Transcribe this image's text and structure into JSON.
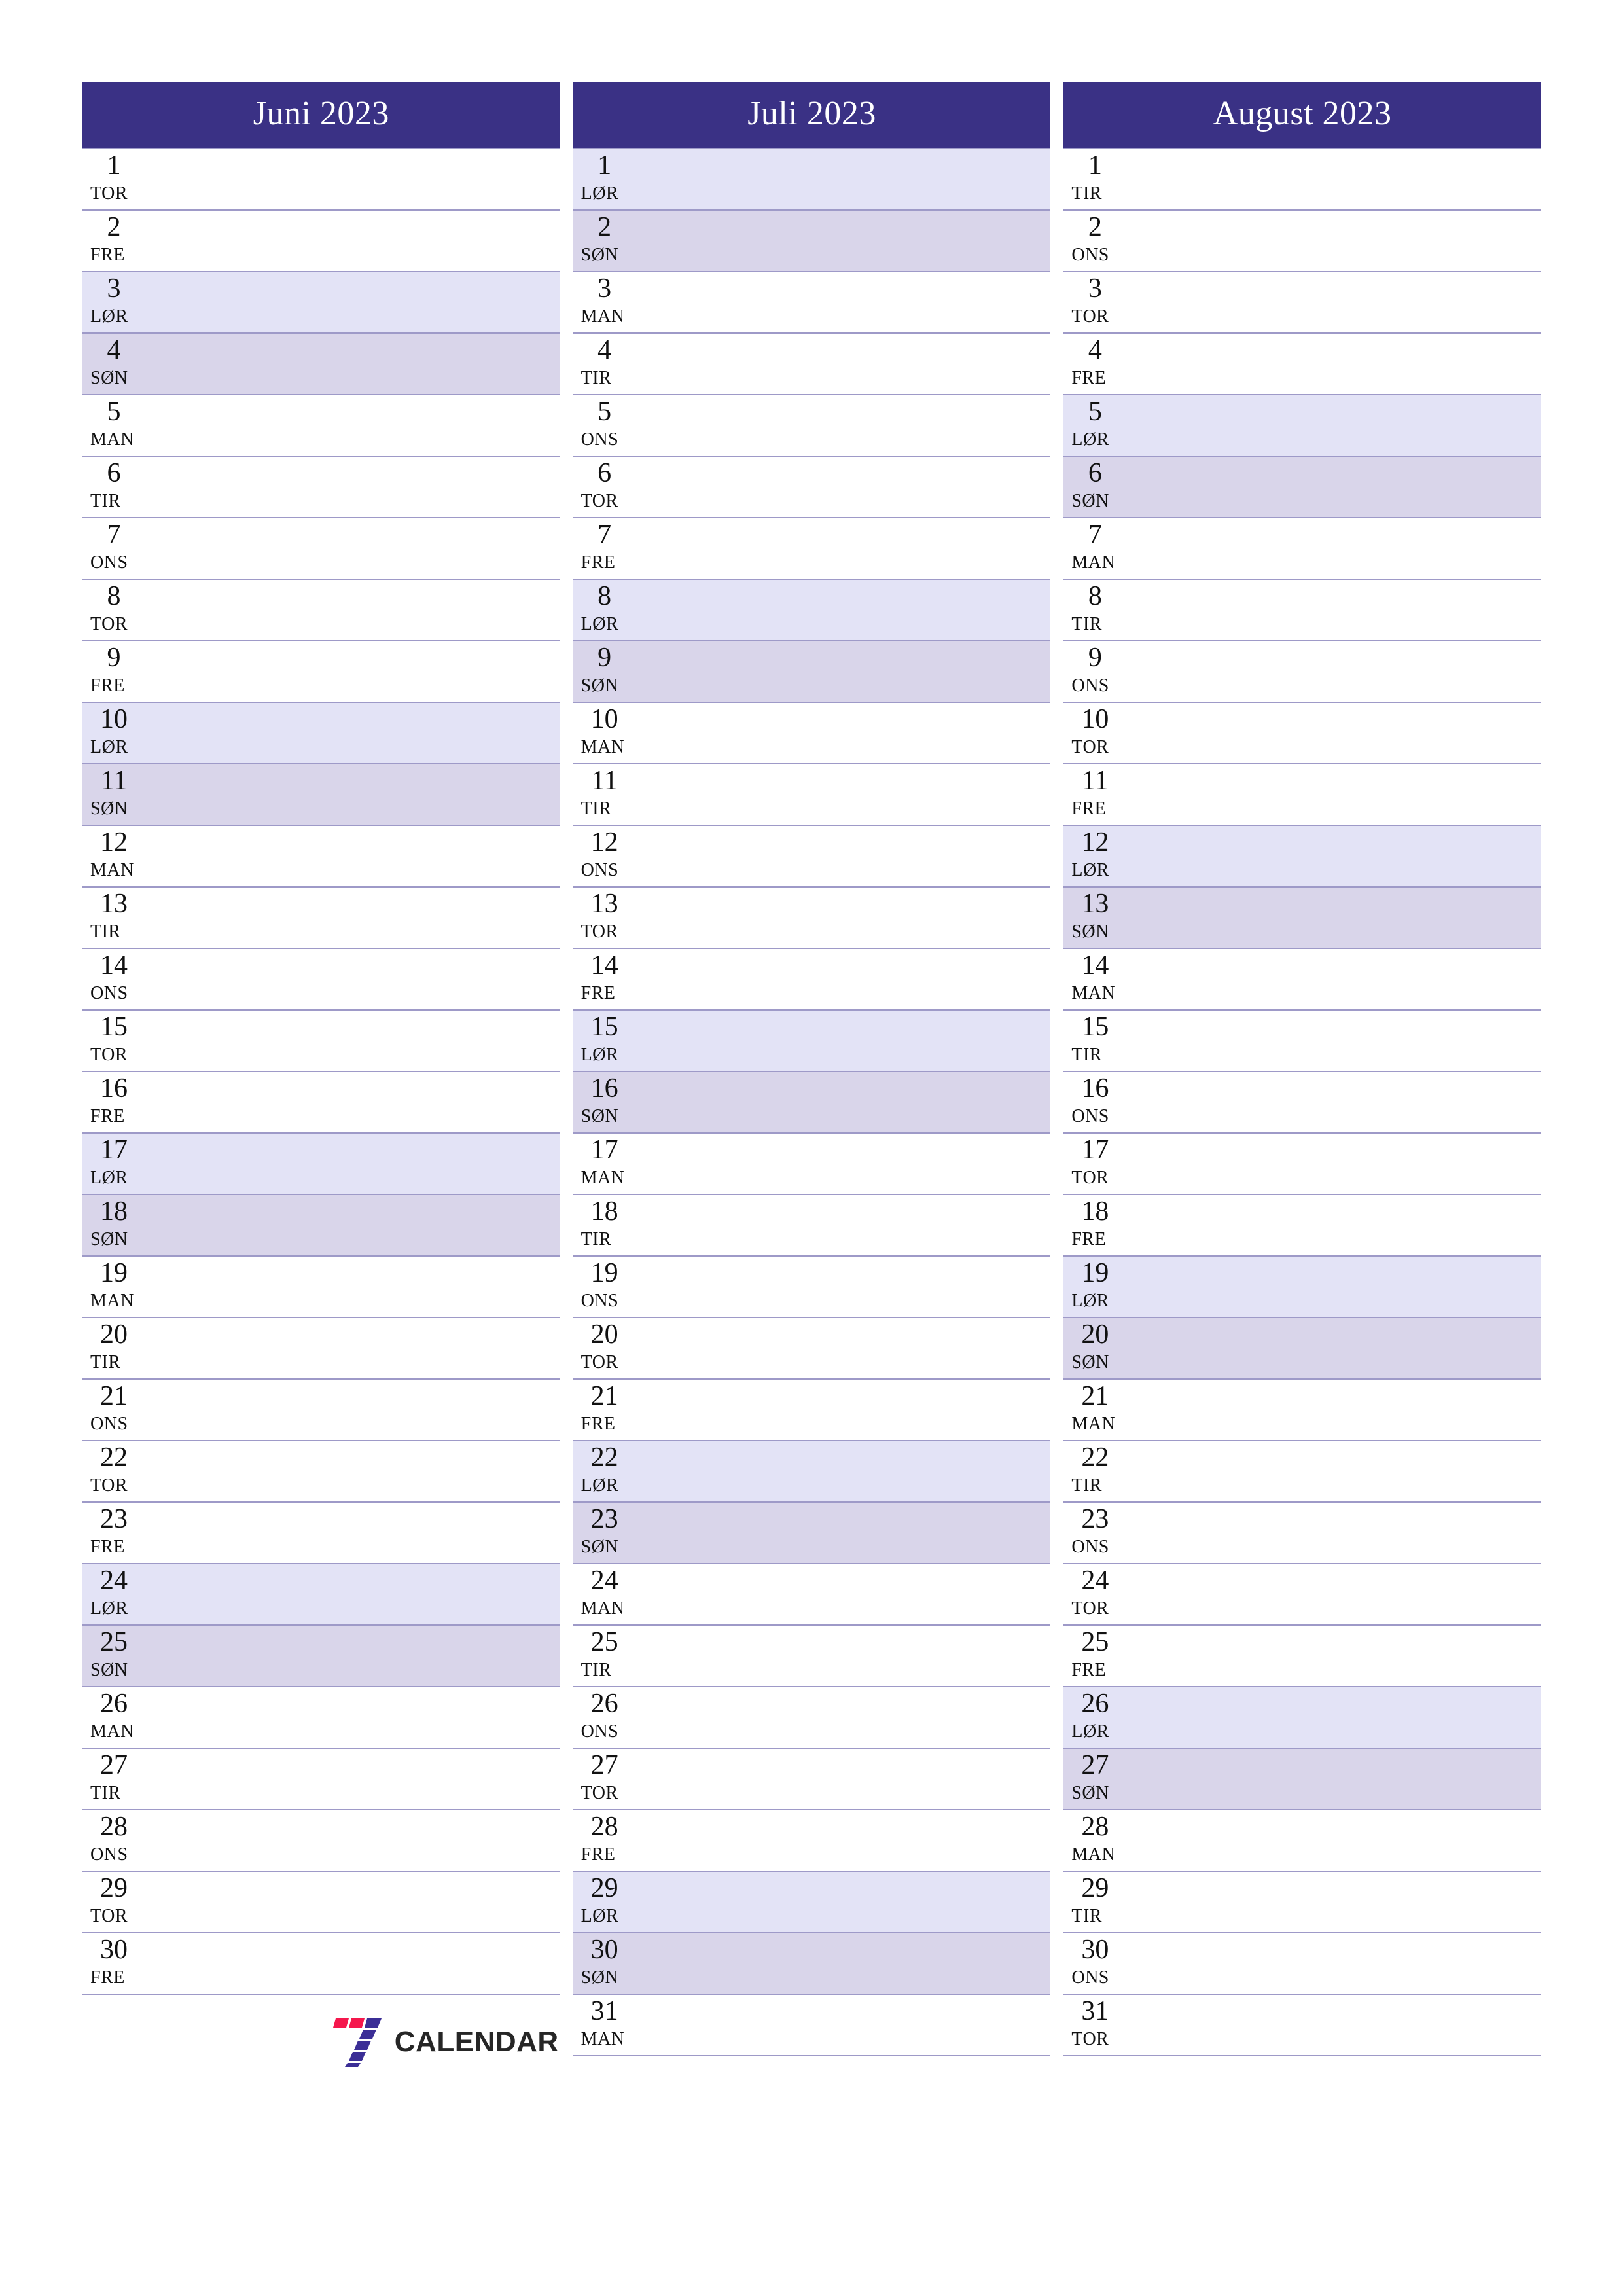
{
  "document": {
    "type": "quarterly-planner",
    "year": "2023",
    "language": "Norwegian",
    "page_background": "#ffffff"
  },
  "colors": {
    "header_background": "#3A3185",
    "header_text": "#ffffff",
    "row_border": "#9e9ac8",
    "saturday_background": "#E3E3F6",
    "sunday_background": "#D9D5EA",
    "day_text": "#111111",
    "logo_red": "#F5174C",
    "logo_purple": "#3B2E96",
    "logo_word": "#262626"
  },
  "months": [
    {
      "title": "Juni 2023",
      "days": [
        {
          "num": "1",
          "name": "TOR",
          "type": "weekday"
        },
        {
          "num": "2",
          "name": "FRE",
          "type": "weekday"
        },
        {
          "num": "3",
          "name": "LØR",
          "type": "saturday"
        },
        {
          "num": "4",
          "name": "SØN",
          "type": "sunday"
        },
        {
          "num": "5",
          "name": "MAN",
          "type": "weekday"
        },
        {
          "num": "6",
          "name": "TIR",
          "type": "weekday"
        },
        {
          "num": "7",
          "name": "ONS",
          "type": "weekday"
        },
        {
          "num": "8",
          "name": "TOR",
          "type": "weekday"
        },
        {
          "num": "9",
          "name": "FRE",
          "type": "weekday"
        },
        {
          "num": "10",
          "name": "LØR",
          "type": "saturday"
        },
        {
          "num": "11",
          "name": "SØN",
          "type": "sunday"
        },
        {
          "num": "12",
          "name": "MAN",
          "type": "weekday"
        },
        {
          "num": "13",
          "name": "TIR",
          "type": "weekday"
        },
        {
          "num": "14",
          "name": "ONS",
          "type": "weekday"
        },
        {
          "num": "15",
          "name": "TOR",
          "type": "weekday"
        },
        {
          "num": "16",
          "name": "FRE",
          "type": "weekday"
        },
        {
          "num": "17",
          "name": "LØR",
          "type": "saturday"
        },
        {
          "num": "18",
          "name": "SØN",
          "type": "sunday"
        },
        {
          "num": "19",
          "name": "MAN",
          "type": "weekday"
        },
        {
          "num": "20",
          "name": "TIR",
          "type": "weekday"
        },
        {
          "num": "21",
          "name": "ONS",
          "type": "weekday"
        },
        {
          "num": "22",
          "name": "TOR",
          "type": "weekday"
        },
        {
          "num": "23",
          "name": "FRE",
          "type": "weekday"
        },
        {
          "num": "24",
          "name": "LØR",
          "type": "saturday"
        },
        {
          "num": "25",
          "name": "SØN",
          "type": "sunday"
        },
        {
          "num": "26",
          "name": "MAN",
          "type": "weekday"
        },
        {
          "num": "27",
          "name": "TIR",
          "type": "weekday"
        },
        {
          "num": "28",
          "name": "ONS",
          "type": "weekday"
        },
        {
          "num": "29",
          "name": "TOR",
          "type": "weekday"
        },
        {
          "num": "30",
          "name": "FRE",
          "type": "weekday"
        }
      ]
    },
    {
      "title": "Juli 2023",
      "days": [
        {
          "num": "1",
          "name": "LØR",
          "type": "saturday"
        },
        {
          "num": "2",
          "name": "SØN",
          "type": "sunday"
        },
        {
          "num": "3",
          "name": "MAN",
          "type": "weekday"
        },
        {
          "num": "4",
          "name": "TIR",
          "type": "weekday"
        },
        {
          "num": "5",
          "name": "ONS",
          "type": "weekday"
        },
        {
          "num": "6",
          "name": "TOR",
          "type": "weekday"
        },
        {
          "num": "7",
          "name": "FRE",
          "type": "weekday"
        },
        {
          "num": "8",
          "name": "LØR",
          "type": "saturday"
        },
        {
          "num": "9",
          "name": "SØN",
          "type": "sunday"
        },
        {
          "num": "10",
          "name": "MAN",
          "type": "weekday"
        },
        {
          "num": "11",
          "name": "TIR",
          "type": "weekday"
        },
        {
          "num": "12",
          "name": "ONS",
          "type": "weekday"
        },
        {
          "num": "13",
          "name": "TOR",
          "type": "weekday"
        },
        {
          "num": "14",
          "name": "FRE",
          "type": "weekday"
        },
        {
          "num": "15",
          "name": "LØR",
          "type": "saturday"
        },
        {
          "num": "16",
          "name": "SØN",
          "type": "sunday"
        },
        {
          "num": "17",
          "name": "MAN",
          "type": "weekday"
        },
        {
          "num": "18",
          "name": "TIR",
          "type": "weekday"
        },
        {
          "num": "19",
          "name": "ONS",
          "type": "weekday"
        },
        {
          "num": "20",
          "name": "TOR",
          "type": "weekday"
        },
        {
          "num": "21",
          "name": "FRE",
          "type": "weekday"
        },
        {
          "num": "22",
          "name": "LØR",
          "type": "saturday"
        },
        {
          "num": "23",
          "name": "SØN",
          "type": "sunday"
        },
        {
          "num": "24",
          "name": "MAN",
          "type": "weekday"
        },
        {
          "num": "25",
          "name": "TIR",
          "type": "weekday"
        },
        {
          "num": "26",
          "name": "ONS",
          "type": "weekday"
        },
        {
          "num": "27",
          "name": "TOR",
          "type": "weekday"
        },
        {
          "num": "28",
          "name": "FRE",
          "type": "weekday"
        },
        {
          "num": "29",
          "name": "LØR",
          "type": "saturday"
        },
        {
          "num": "30",
          "name": "SØN",
          "type": "sunday"
        },
        {
          "num": "31",
          "name": "MAN",
          "type": "weekday"
        }
      ]
    },
    {
      "title": "August 2023",
      "days": [
        {
          "num": "1",
          "name": "TIR",
          "type": "weekday"
        },
        {
          "num": "2",
          "name": "ONS",
          "type": "weekday"
        },
        {
          "num": "3",
          "name": "TOR",
          "type": "weekday"
        },
        {
          "num": "4",
          "name": "FRE",
          "type": "weekday"
        },
        {
          "num": "5",
          "name": "LØR",
          "type": "saturday"
        },
        {
          "num": "6",
          "name": "SØN",
          "type": "sunday"
        },
        {
          "num": "7",
          "name": "MAN",
          "type": "weekday"
        },
        {
          "num": "8",
          "name": "TIR",
          "type": "weekday"
        },
        {
          "num": "9",
          "name": "ONS",
          "type": "weekday"
        },
        {
          "num": "10",
          "name": "TOR",
          "type": "weekday"
        },
        {
          "num": "11",
          "name": "FRE",
          "type": "weekday"
        },
        {
          "num": "12",
          "name": "LØR",
          "type": "saturday"
        },
        {
          "num": "13",
          "name": "SØN",
          "type": "sunday"
        },
        {
          "num": "14",
          "name": "MAN",
          "type": "weekday"
        },
        {
          "num": "15",
          "name": "TIR",
          "type": "weekday"
        },
        {
          "num": "16",
          "name": "ONS",
          "type": "weekday"
        },
        {
          "num": "17",
          "name": "TOR",
          "type": "weekday"
        },
        {
          "num": "18",
          "name": "FRE",
          "type": "weekday"
        },
        {
          "num": "19",
          "name": "LØR",
          "type": "saturday"
        },
        {
          "num": "20",
          "name": "SØN",
          "type": "sunday"
        },
        {
          "num": "21",
          "name": "MAN",
          "type": "weekday"
        },
        {
          "num": "22",
          "name": "TIR",
          "type": "weekday"
        },
        {
          "num": "23",
          "name": "ONS",
          "type": "weekday"
        },
        {
          "num": "24",
          "name": "TOR",
          "type": "weekday"
        },
        {
          "num": "25",
          "name": "FRE",
          "type": "weekday"
        },
        {
          "num": "26",
          "name": "LØR",
          "type": "saturday"
        },
        {
          "num": "27",
          "name": "SØN",
          "type": "sunday"
        },
        {
          "num": "28",
          "name": "MAN",
          "type": "weekday"
        },
        {
          "num": "29",
          "name": "TIR",
          "type": "weekday"
        },
        {
          "num": "30",
          "name": "ONS",
          "type": "weekday"
        },
        {
          "num": "31",
          "name": "TOR",
          "type": "weekday"
        }
      ]
    }
  ],
  "footer": {
    "logo_word": "CALENDAR",
    "logo_mark_name": "seven-calendar-logo"
  }
}
